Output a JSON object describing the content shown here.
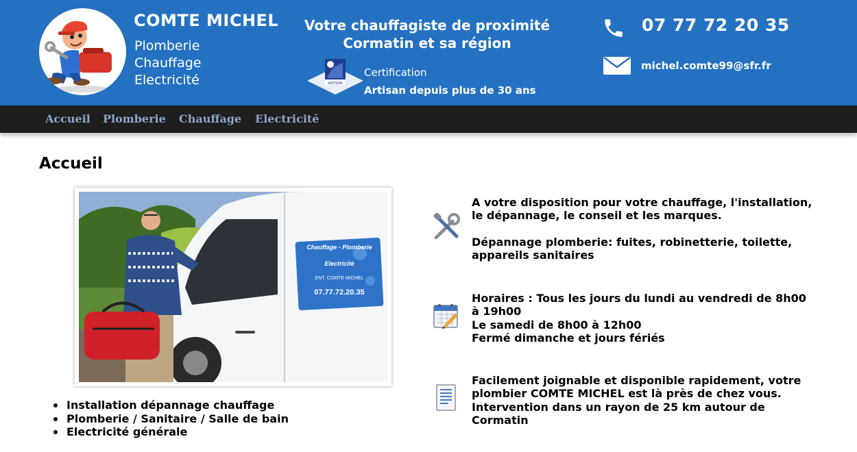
{
  "header": {
    "brand_name": "COMTE MICHEL",
    "services": [
      "Plomberie",
      "Chauffage",
      "Electricité"
    ],
    "tagline_line1": "Votre chauffagiste de proximité",
    "tagline_line2": "Cormatin et sa région",
    "cert_badge_text": "ARTISAN",
    "cert_label": "Certification",
    "cert_text": "Artisan depuis plus de 30 ans",
    "phone": "07 77 72 20 35",
    "email": "michel.comte99@sfr.fr",
    "colors": {
      "header_bg": "#2471c2",
      "navbar_bg": "#1e1e1e",
      "nav_text": "#8fa3c9"
    }
  },
  "nav": {
    "items": [
      {
        "label": "Accueil"
      },
      {
        "label": "Plomberie"
      },
      {
        "label": "Chauffage"
      },
      {
        "label": "Electricité"
      }
    ]
  },
  "main": {
    "title": "Accueil",
    "photo": {
      "van_text": [
        "Chauffage - Plomberie",
        "Electricité",
        "ENT. COMTE MICHEL",
        "07.77.72.20.35"
      ]
    },
    "bullets": [
      "Installation dépannage chauffage",
      "Plomberie / Sanitaire / Salle de bain",
      "Electricité générale"
    ],
    "info_blocks": [
      {
        "icon": "tools-icon",
        "paragraphs": [
          [
            "A votre disposition pour votre chauffage, l'installation,",
            "le dépannage, le conseil et les marques."
          ],
          [
            "Dépannage plomberie: fuites, robinetterie, toilette,",
            "appareils sanitaires"
          ]
        ]
      },
      {
        "icon": "calendar-icon",
        "lines": [
          "Horaires : Tous les jours du lundi au vendredi de 8h00",
          "à 19h00",
          "Le samedi de 8h00 à 12h00",
          "Fermé dimanche et jours fériés"
        ]
      },
      {
        "icon": "document-icon",
        "lines": [
          "Facilement joignable et disponible rapidement, votre",
          "plombier COMTE MICHEL est là près de chez vous.",
          "Intervention dans un rayon de 25 km autour de",
          "Cormatin"
        ]
      }
    ]
  }
}
